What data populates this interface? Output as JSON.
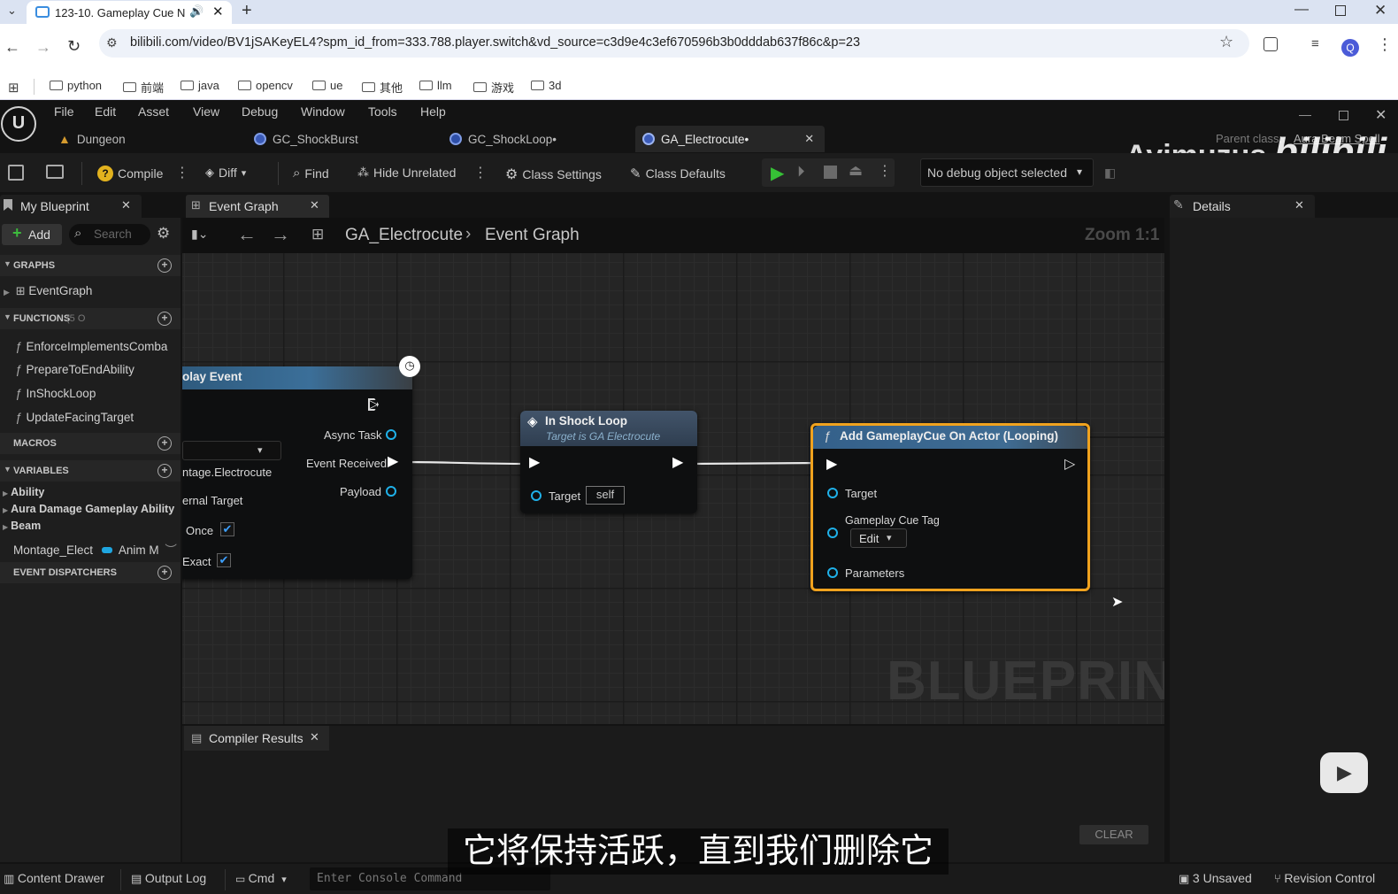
{
  "browser": {
    "tab_title": "123-10. Gameplay Cue N",
    "url": "bilibili.com/video/BV1jSAKeyEL4?spm_id_from=333.788.player.switch&vd_source=c3d9e4c3ef670596b3b0dddab637f86c&p=23",
    "profile_initial": "Q",
    "bookmarks": [
      "python",
      "前端",
      "java",
      "opencv",
      "ue",
      "其他",
      "llm",
      "游戏",
      "3d"
    ]
  },
  "ue": {
    "menu": [
      "File",
      "Edit",
      "Asset",
      "View",
      "Debug",
      "Window",
      "Tools",
      "Help"
    ],
    "doc_tabs": [
      "Dungeon",
      "GC_ShockBurst",
      "GC_ShockLoop•",
      "GA_Electrocute•"
    ],
    "parent_class_label": "Parent class:",
    "parent_class_value": "Aura Beam Spell",
    "watermark": {
      "uploader": "Ayimuzus",
      "site": "bilibili"
    },
    "toolbar": {
      "compile": "Compile",
      "diff": "Diff",
      "find": "Find",
      "hide_unrelated": "Hide Unrelated",
      "class_settings": "Class Settings",
      "class_defaults": "Class Defaults",
      "debug_object": "No debug object selected"
    },
    "my_blueprint": {
      "title": "My Blueprint",
      "add": "Add",
      "search_placeholder": "Search",
      "graphs_header": "GRAPHS",
      "event_graph": "EventGraph",
      "functions_header": "FUNCTIONS",
      "functions_count": "(5 O",
      "functions": [
        "EnforceImplementsComba",
        "PrepareToEndAbility",
        "InShockLoop",
        "UpdateFacingTarget"
      ],
      "macros_header": "MACROS",
      "variables_header": "VARIABLES",
      "variable_groups": [
        "Ability",
        "Aura Damage Gameplay Ability",
        "Beam"
      ],
      "variable_item": {
        "name": "Montage_Elect",
        "type": "Anim M"
      },
      "event_dispatchers_header": "EVENT DISPATCHERS"
    },
    "graph_tab": "Event Graph",
    "breadcrumb": {
      "blueprint": "GA_Electrocute",
      "graph": "Event Graph"
    },
    "zoom": "Zoom 1:1",
    "watermark_text": "BLUEPRINT",
    "nodes": {
      "play_event": {
        "title": "olay Event",
        "async_task": "Async Task",
        "event_received": "Event Received",
        "payload": "Payload",
        "montage_value": "ntage.Electrocute",
        "external_target": "ernal Target",
        "once": "Once",
        "exact": "Exact"
      },
      "in_shock_loop": {
        "title": "In Shock Loop",
        "subtitle": "Target is GA Electrocute",
        "target": "Target",
        "target_value": "self"
      },
      "add_cue": {
        "title": "Add GameplayCue On Actor (Looping)",
        "target": "Target",
        "tag": "Gameplay Cue Tag",
        "edit": "Edit",
        "parameters": "Parameters"
      }
    },
    "details_title": "Details",
    "compiler_results": "Compiler Results",
    "clear": "CLEAR",
    "status": {
      "content_drawer": "Content Drawer",
      "output_log": "Output Log",
      "cmd": "Cmd",
      "console_placeholder": "Enter Console Command",
      "unsaved": "3 Unsaved",
      "revision": "Revision Control"
    }
  },
  "subtitle": "它将保持活跃，直到我们删除它"
}
